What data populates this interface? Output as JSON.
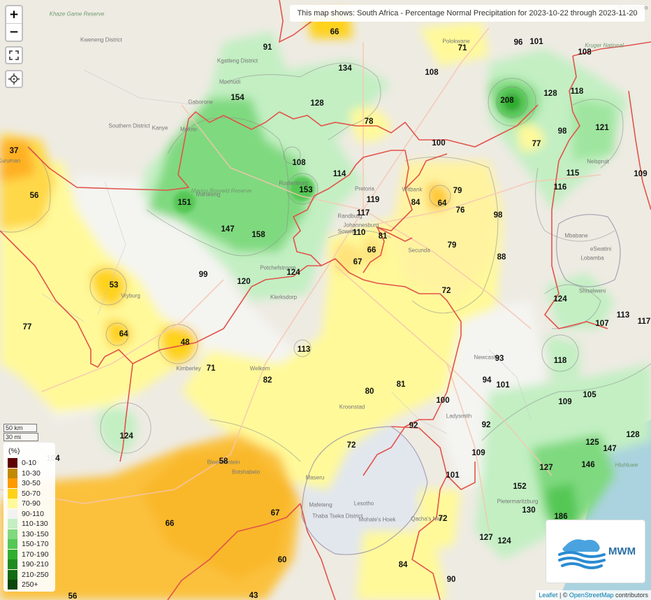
{
  "title": "This map shows: South Africa - Percentage Normal Precipitation for 2023-10-22 through 2023-11-20",
  "controls": {
    "zoom_in": "+",
    "zoom_out": "−",
    "fullscreen_icon": "fullscreen-icon",
    "locate_icon": "crosshair-icon"
  },
  "scale": {
    "km": "50 km",
    "mi": "30 mi"
  },
  "legend": {
    "unit": "(%)",
    "items": [
      {
        "label": "0-10",
        "color": "#5e0000"
      },
      {
        "label": "10-30",
        "color": "#c28a00"
      },
      {
        "label": "30-50",
        "color": "#ff9900"
      },
      {
        "label": "50-70",
        "color": "#ffd21a"
      },
      {
        "label": "70-90",
        "color": "#fff99a"
      },
      {
        "label": "90-110",
        "color": "#f2f2f2"
      },
      {
        "label": "110-130",
        "color": "#c3efc3"
      },
      {
        "label": "130-150",
        "color": "#7fd97f"
      },
      {
        "label": "150-170",
        "color": "#55c755"
      },
      {
        "label": "170-190",
        "color": "#2fae2f"
      },
      {
        "label": "190-210",
        "color": "#1f8a1f"
      },
      {
        "label": "210-250",
        "color": "#136b13"
      },
      {
        "label": "250+",
        "color": "#0a460a"
      }
    ]
  },
  "logo": {
    "text": "MWM"
  },
  "attribution": {
    "leaflet": "Leaflet",
    "separator": " | © ",
    "osm": "OpenStreetMap",
    "suffix": " contributors"
  },
  "values": [
    "66",
    "91",
    "71",
    "96",
    "101",
    "108",
    "134",
    "108",
    "118",
    "154",
    "128",
    "208",
    "128",
    "78",
    "100",
    "98",
    "121",
    "77",
    "37",
    "108",
    "114",
    "115",
    "109",
    "56",
    "153",
    "119",
    "79",
    "116",
    "151",
    "84",
    "64",
    "76",
    "98",
    "147",
    "117",
    "158",
    "110",
    "81",
    "79",
    "66",
    "67",
    "88",
    "99",
    "124",
    "120",
    "53",
    "72",
    "124",
    "77",
    "107",
    "113",
    "117",
    "64",
    "48",
    "113",
    "93",
    "118",
    "71",
    "82",
    "94",
    "101",
    "80",
    "81",
    "109",
    "105",
    "100",
    "92",
    "92",
    "124",
    "125",
    "147",
    "128",
    "72",
    "104",
    "109",
    "146",
    "58",
    "101",
    "127",
    "152",
    "130",
    "66",
    "67",
    "72",
    "186",
    "127",
    "124",
    "60",
    "84",
    "90",
    "56",
    "43"
  ],
  "places": [
    "Khaze Game Reserve",
    "Kweneng District",
    "Kgatleng District",
    "Mochudi",
    "Gaborone",
    "Southern District",
    "Kanye",
    "Moloto",
    "Polokwane",
    "Kruger National",
    "Marico Bosveld Reserve",
    "Rustenburg",
    "Pretoria",
    "Johannesburg",
    "Soweto",
    "Randburg",
    "Secunda",
    "Potchefstroom",
    "Welkom",
    "Bloemfontein",
    "Botshabelo",
    "Maseru",
    "Lesotho",
    "Mbabane",
    "eSwatini",
    "Lobamba",
    "Shiselweni",
    "Pietermaritzburg",
    "Ladysmith",
    "Newcastle",
    "Hluhluwe",
    "Kuruman",
    "Vryburg",
    "Mahikeng",
    "Kimberley",
    "Thaba Tseka District",
    "Mafeteng",
    "Mohale's Hoek",
    "Qacha's Nek",
    "Bo Limpopo",
    "Klerksdorp",
    "Kroonstad",
    "Nelspruit",
    "Witbank"
  ]
}
